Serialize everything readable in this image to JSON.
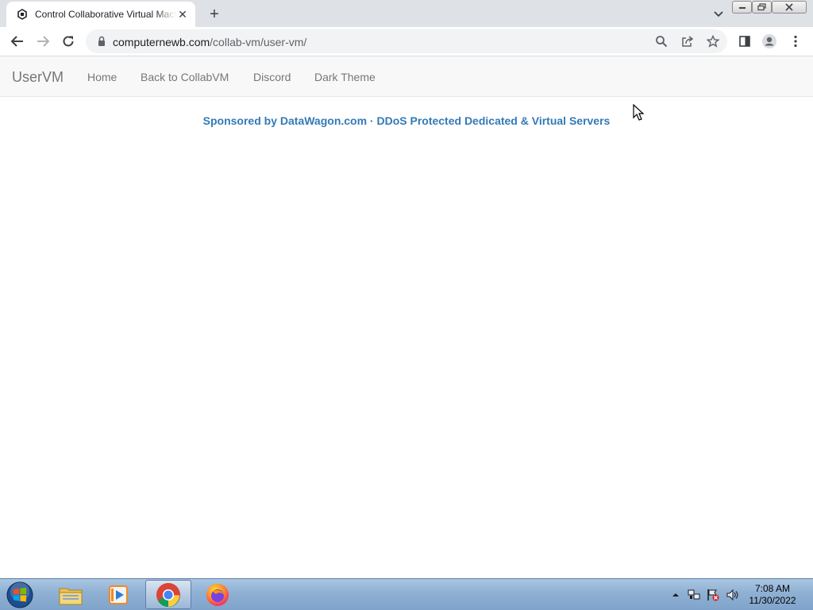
{
  "browser": {
    "tab_title": "Control Collaborative Virtual Machines",
    "new_tab": "+",
    "url_host": "computernewb.com",
    "url_path": "/collab-vm/user-vm/"
  },
  "navbar": {
    "brand": "UserVM",
    "links": [
      {
        "label": "Home"
      },
      {
        "label": "Back to CollabVM"
      },
      {
        "label": "Discord"
      },
      {
        "label": "Dark Theme"
      }
    ]
  },
  "sponsor": {
    "text": "Sponsored by DataWagon.com · DDoS Protected Dedicated & Virtual Servers"
  },
  "taskbar": {
    "time": "7:08 AM",
    "date": "11/30/2022"
  },
  "colors": {
    "link": "#337ab7",
    "nav_text": "#777777"
  }
}
